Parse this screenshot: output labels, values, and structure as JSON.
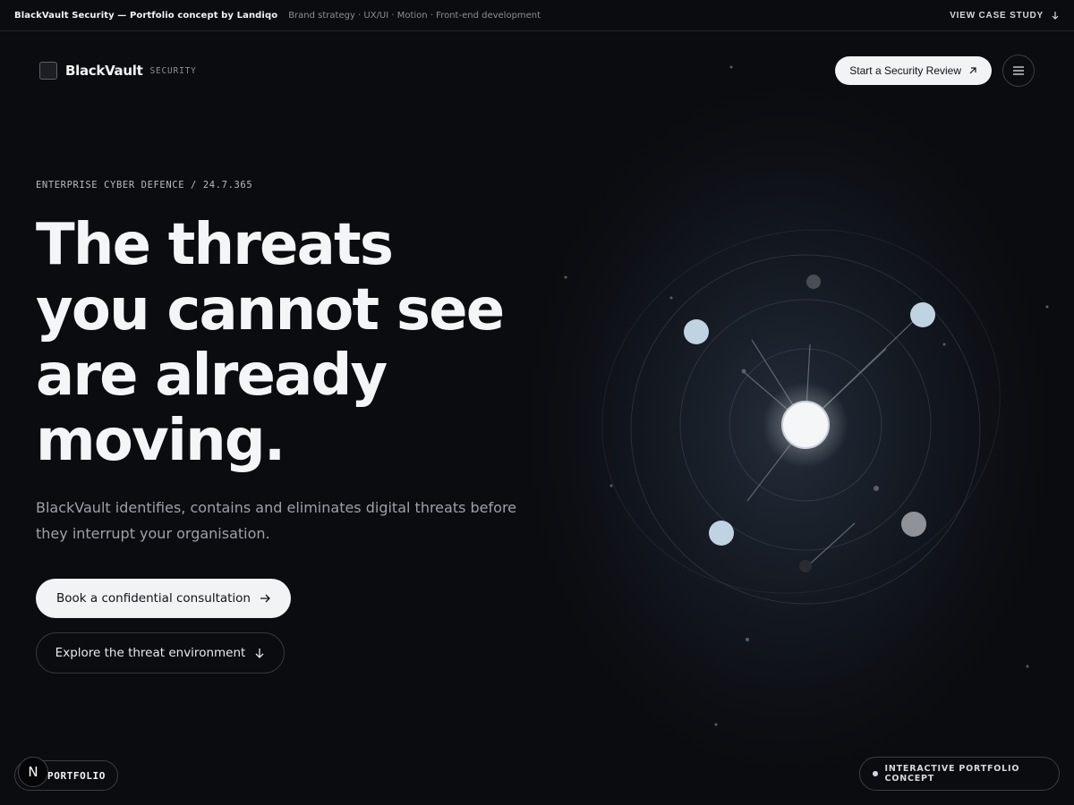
{
  "topbar": {
    "title": "BlackVault Security — Portfolio concept by Landiqo",
    "subtitle": "Brand strategy · UX/UI · Motion · Front-end development",
    "case_study_label": "VIEW CASE STUDY",
    "case_study_icon": "arrow-down-icon"
  },
  "nav": {
    "brand_name": "BlackVault",
    "brand_tag": "SECURITY",
    "cta_label": "Start a Security Review",
    "cta_icon": "arrow-up-right-icon",
    "menu_icon": "hamburger-menu-icon"
  },
  "hero": {
    "eyebrow": "ENTERPRISE CYBER DEFENCE / 24.7.365",
    "headline_lines": [
      "The threats",
      "you cannot see",
      "are already",
      "moving."
    ],
    "lede": "BlackVault identifies, contains and eliminates digital threats before they interrupt your organisation.",
    "primary_cta": "Book a confidential consultation",
    "secondary_cta": "Explore the threat environment"
  },
  "footer": {
    "n_badge": "N",
    "portfolio_label": "PORTFOLIO",
    "concept_label": "INTERACTIVE PORTFOLIO CONCEPT"
  },
  "colors": {
    "background": "#0b0c10",
    "text": "#f2f3f5",
    "muted": "#9da0a8",
    "node": "#bfd3e3",
    "node_grey": "#8f9297"
  }
}
